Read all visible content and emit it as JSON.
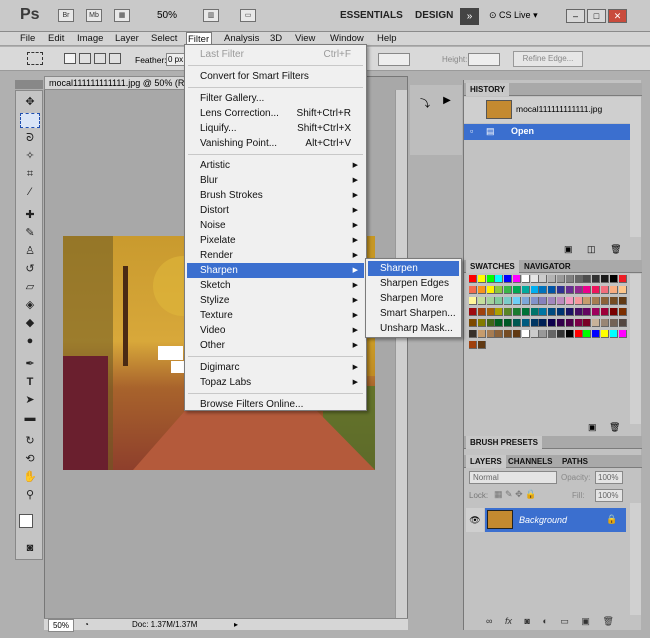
{
  "app": {
    "logo": "Ps",
    "zoom": "50%",
    "workspaces": [
      "ESSENTIALS",
      "DESIGN"
    ],
    "cslive": "CS Live"
  },
  "menubar": [
    "File",
    "Edit",
    "Image",
    "Layer",
    "Select",
    "Filter",
    "Analysis",
    "3D",
    "View",
    "Window",
    "Help"
  ],
  "options": {
    "feather_label": "Feather:",
    "feather_value": "0 px",
    "refine_edge": "Refine Edge...",
    "height_label": "Height:"
  },
  "document": {
    "tab_title": "mocal111111111111.jpg @ 50% (RGB/8)",
    "status_zoom": "50%",
    "status_doc": "Doc: 1.37M/1.37M"
  },
  "filter_menu": {
    "items": [
      {
        "label": "Last Filter",
        "shortcut": "Ctrl+F",
        "disabled": true
      },
      {
        "sep": true
      },
      {
        "label": "Convert for Smart Filters"
      },
      {
        "sep": true
      },
      {
        "label": "Filter Gallery..."
      },
      {
        "label": "Lens Correction...",
        "shortcut": "Shift+Ctrl+R"
      },
      {
        "label": "Liquify...",
        "shortcut": "Shift+Ctrl+X"
      },
      {
        "label": "Vanishing Point...",
        "shortcut": "Alt+Ctrl+V"
      },
      {
        "sep": true
      },
      {
        "label": "Artistic",
        "submenu": true
      },
      {
        "label": "Blur",
        "submenu": true
      },
      {
        "label": "Brush Strokes",
        "submenu": true
      },
      {
        "label": "Distort",
        "submenu": true
      },
      {
        "label": "Noise",
        "submenu": true
      },
      {
        "label": "Pixelate",
        "submenu": true
      },
      {
        "label": "Render",
        "submenu": true
      },
      {
        "label": "Sharpen",
        "submenu": true,
        "highlighted": true
      },
      {
        "label": "Sketch",
        "submenu": true
      },
      {
        "label": "Stylize",
        "submenu": true
      },
      {
        "label": "Texture",
        "submenu": true
      },
      {
        "label": "Video",
        "submenu": true
      },
      {
        "label": "Other",
        "submenu": true
      },
      {
        "sep": true
      },
      {
        "label": "Digimarc",
        "submenu": true
      },
      {
        "label": "Topaz Labs",
        "submenu": true
      },
      {
        "sep": true
      },
      {
        "label": "Browse Filters Online..."
      }
    ]
  },
  "sharpen_submenu": [
    {
      "label": "Sharpen",
      "highlighted": true
    },
    {
      "label": "Sharpen Edges"
    },
    {
      "label": "Sharpen More"
    },
    {
      "label": "Smart Sharpen..."
    },
    {
      "label": "Unsharp Mask..."
    }
  ],
  "history": {
    "tab": "HISTORY",
    "snapshot": "mocal111111111111.jpg",
    "step": "Open"
  },
  "swatches": {
    "tabs": [
      "SWATCHES",
      "NAVIGATOR"
    ]
  },
  "brush_presets": {
    "tab": "BRUSH PRESETS"
  },
  "layers": {
    "tabs": [
      "LAYERS",
      "CHANNELS",
      "PATHS"
    ],
    "blend_mode": "Normal",
    "opacity_label": "Opacity:",
    "opacity": "100%",
    "lock_label": "Lock:",
    "fill_label": "Fill:",
    "fill": "100%",
    "layer_name": "Background"
  },
  "colors": {
    "accent": "#3b6fcf",
    "panel": "#c2c2c2"
  }
}
